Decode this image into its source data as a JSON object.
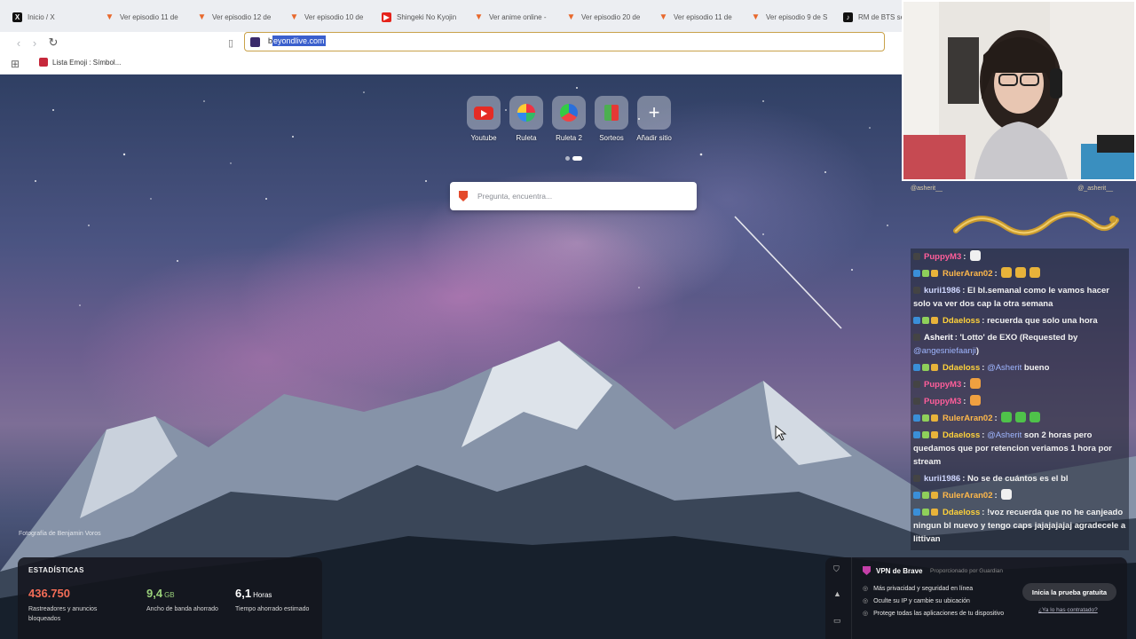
{
  "tabs": [
    {
      "title": "Inicio / X",
      "icon": "x-logo-icon"
    },
    {
      "title": "Ver episodio 11 de",
      "icon": "fox-favicon-icon"
    },
    {
      "title": "Ver episodio 12 de",
      "icon": "fox-favicon-icon"
    },
    {
      "title": "Ver episodio 10 de",
      "icon": "fox-favicon-icon"
    },
    {
      "title": "Shingeki No Kyojin",
      "icon": "youtube-favicon-icon"
    },
    {
      "title": "Ver anime online -",
      "icon": "fox-favicon-icon"
    },
    {
      "title": "Ver episodio 20 de",
      "icon": "fox-favicon-icon"
    },
    {
      "title": "Ver episodio 11 de",
      "icon": "fox-favicon-icon"
    },
    {
      "title": "Ver episodio 9 de S",
      "icon": "fox-favicon-icon"
    },
    {
      "title": "RM de BTS se l",
      "icon": "tiktok-favicon-icon"
    }
  ],
  "toolbar": {
    "url_first_char": "b",
    "url_selected": "eyondlive.com"
  },
  "bookmarks": [
    {
      "label": "Lista Emoji : Símbol..."
    }
  ],
  "top_sites": [
    {
      "label": "Youtube",
      "icon": "youtube-icon"
    },
    {
      "label": "Ruleta",
      "icon": "wheel-icon"
    },
    {
      "label": "Ruleta 2",
      "icon": "wheel-icon"
    },
    {
      "label": "Sorteos",
      "icon": "gift-icon"
    },
    {
      "label": "Añadir sitio",
      "icon": "plus-icon"
    }
  ],
  "search": {
    "placeholder": "Pregunta, encuentra..."
  },
  "photo_credit": "Fotografía de Benjamin Voros",
  "stats": {
    "heading": "ESTADÍSTICAS",
    "items": [
      {
        "value": "436.750",
        "unit": "",
        "desc": "Rastreadores y anuncios bloqueados",
        "color": "#f36d57"
      },
      {
        "value": "9,4",
        "unit": "GB",
        "desc": "Ancho de banda ahorrado",
        "color": "#9ad07a"
      },
      {
        "value": "6,1",
        "unit": "Horas",
        "desc": "Tiempo ahorrado estimado",
        "color": "#ffffff"
      }
    ]
  },
  "vpn": {
    "title": "VPN de Brave",
    "provider": "Proporcionado por  Guardian",
    "features": [
      "Más privacidad y seguridad en línea",
      "Oculte su IP y cambie su ubicación",
      "Protege todas las aplicaciones de tu dispositivo"
    ],
    "cta": "Inicia la prueba gratuita",
    "already": "¿Ya lo has contratado?"
  },
  "chat_header": {
    "left": "@asherit__",
    "right": "@_asherit__"
  },
  "chat": [
    {
      "nick": "PuppyM3",
      "color": "#ff5e9a",
      "parts": [
        {
          "t": "emote",
          "c": "#f0f0f0"
        }
      ]
    },
    {
      "nick": "RulerAran02",
      "color": "#ffb84a",
      "badges": true,
      "parts": [
        {
          "t": "emote",
          "c": "#e8b33a"
        },
        {
          "t": "emote",
          "c": "#e8b33a"
        },
        {
          "t": "emote",
          "c": "#e8b33a"
        }
      ]
    },
    {
      "nick": "kurii1986",
      "color": "#d0d8ff",
      "parts": [
        {
          "t": "text",
          "v": "El bl.semanal como le vamos hacer solo va ver dos cap la otra semana"
        }
      ]
    },
    {
      "nick": "Ddaeloss",
      "color": "#ffd23a",
      "badges": true,
      "parts": [
        {
          "t": "text",
          "v": "recuerda que solo una hora"
        }
      ]
    },
    {
      "nick": "Asherit",
      "color": "#ffffff",
      "parts": [
        {
          "t": "text",
          "v": "'Lotto' de EXO (Requested by "
        },
        {
          "t": "mention",
          "v": "@angesniefaanji"
        },
        {
          "t": "text",
          "v": ")"
        }
      ]
    },
    {
      "nick": "Ddaeloss",
      "color": "#ffd23a",
      "badges": true,
      "parts": [
        {
          "t": "mention",
          "v": "@Asherit"
        },
        {
          "t": "text",
          "v": " bueno"
        }
      ]
    },
    {
      "nick": "PuppyM3",
      "color": "#ff5e9a",
      "parts": [
        {
          "t": "emote",
          "c": "#f0a040"
        }
      ]
    },
    {
      "nick": "PuppyM3",
      "color": "#ff5e9a",
      "parts": [
        {
          "t": "emote",
          "c": "#f0a040"
        }
      ]
    },
    {
      "nick": "RulerAran02",
      "color": "#ffb84a",
      "badges": true,
      "parts": [
        {
          "t": "emote",
          "c": "#4fc24a"
        },
        {
          "t": "emote",
          "c": "#4fc24a"
        },
        {
          "t": "emote",
          "c": "#4fc24a"
        }
      ]
    },
    {
      "nick": "Ddaeloss",
      "color": "#ffd23a",
      "badges": true,
      "parts": [
        {
          "t": "mention",
          "v": "@Asherit"
        },
        {
          "t": "text",
          "v": " son 2 horas pero quedamos que por retencion veriamos 1 hora por stream"
        }
      ]
    },
    {
      "nick": "kurii1986",
      "color": "#d0d8ff",
      "parts": [
        {
          "t": "text",
          "v": "No se de cuántos es el bl"
        }
      ]
    },
    {
      "nick": "RulerAran02",
      "color": "#ffb84a",
      "badges": true,
      "parts": [
        {
          "t": "emote",
          "c": "#f0f0f0"
        }
      ]
    },
    {
      "nick": "Ddaeloss",
      "color": "#ffd23a",
      "badges": true,
      "parts": [
        {
          "t": "text",
          "v": "!voz recuerda que no he canjeado ningun bl nuevo y tengo caps jajajajajaj agradecele a littivan"
        }
      ]
    }
  ]
}
